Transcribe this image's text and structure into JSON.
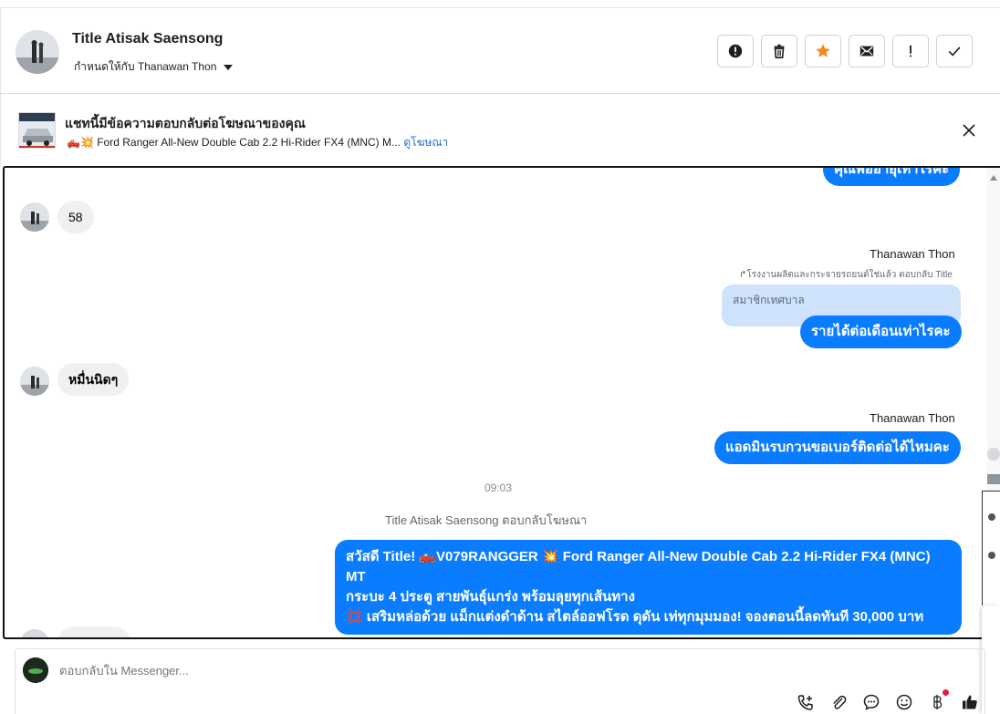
{
  "header": {
    "contact_name": "Title Atisak Saensong",
    "assigned_to": "กำหนดให้กับ Thanawan Thon",
    "actions": [
      {
        "icon": "alert-circle-icon",
        "name": "report-button"
      },
      {
        "icon": "trash-icon",
        "name": "delete-button"
      },
      {
        "icon": "star-icon",
        "name": "star-button"
      },
      {
        "icon": "envelope-icon",
        "name": "mark-unread-button"
      },
      {
        "icon": "exclamation-icon",
        "name": "spam-button"
      },
      {
        "icon": "check-icon",
        "name": "mark-done-button"
      }
    ],
    "star_color": "#f28b1e"
  },
  "ad": {
    "title": "แชทนี้มีข้อความตอบกลับต่อโฆษณาของคุณ",
    "subtitle": "🛻💥 Ford Ranger All-New Double Cab 2.2 Hi-Rider FX4 (MNC) M...",
    "link_label": "ดูโฆษณา"
  },
  "chat": {
    "partial_top_out": "คุณพ่ออายุเท่าไรคะ",
    "msg_58": "58",
    "sender_1": "Thanawan Thon",
    "reply_note": "↱โรงงานผลิตและกระจายรถยนต์ใช่แล้ว ตอบกลับ Title",
    "quoted_text": "สมาชิกเทศบาล",
    "out_1": "รายได้ต่อเดือนเท่าไรคะ",
    "in_2": "หมื่นนิดๆ",
    "sender_2": "Thanawan Thon",
    "out_2": "แอดมินรบกวนขอเบอร์ติดต่อได้ไหมคะ",
    "time": "09:03",
    "system_line": "Title Atisak Saensong ตอบกลับโฆษณา",
    "ad_reply_line1": "สวัสดี Title! 🛻V079RANGGER 💥 Ford Ranger All-New Double Cab 2.2 Hi-Rider FX4 (MNC) MT",
    "ad_reply_line2": "กระบะ 4 ประตู สายพันธุ์แกร่ง พร้อมลุยทุกเส้นทาง",
    "ad_reply_line3": "💢 เสริมหล่อด้วย แม็กแต่งดำด้าน สไตล์ออฟโรด ดุดัน เท่ทุกมุมมอง! จองตอนนี้ลดทันที 30,000 บาท"
  },
  "composer": {
    "placeholder": "ตอบกลับใน Messenger...",
    "tools": [
      "phone-plus-icon",
      "paperclip-icon",
      "saved-reply-icon",
      "emoji-icon",
      "baht-icon",
      "like-icon"
    ]
  },
  "colors": {
    "outgoing_bubble": "#0a7cff",
    "incoming_bubble": "#f0f0f0",
    "link": "#216fdb"
  }
}
